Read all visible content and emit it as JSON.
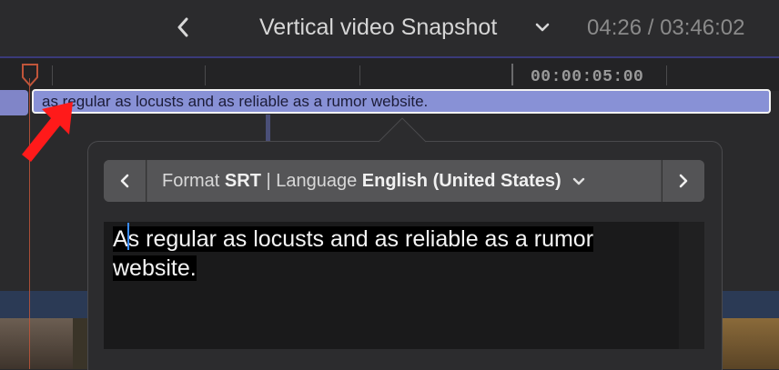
{
  "header": {
    "back_label": "<",
    "project_title": "Vertical video Snapshot",
    "timecode": "04:26 / 03:46:02"
  },
  "ruler": {
    "time_label": "00:00:05:00"
  },
  "timeline": {
    "caption_clip_text": "as regular as locusts and as reliable as a rumor website."
  },
  "popover": {
    "format_label": "Format",
    "format_value": "SRT",
    "separator": "|",
    "language_label": "Language",
    "language_value": "English (United States)",
    "caption_line1": "As regular as locusts and as reliable as a rumor",
    "caption_line2": "website."
  },
  "colors": {
    "caption_clip": "#8891d6",
    "playhead": "#c0553a",
    "annotation_arrow": "#ff1a1a",
    "caret": "#3a8cff"
  }
}
